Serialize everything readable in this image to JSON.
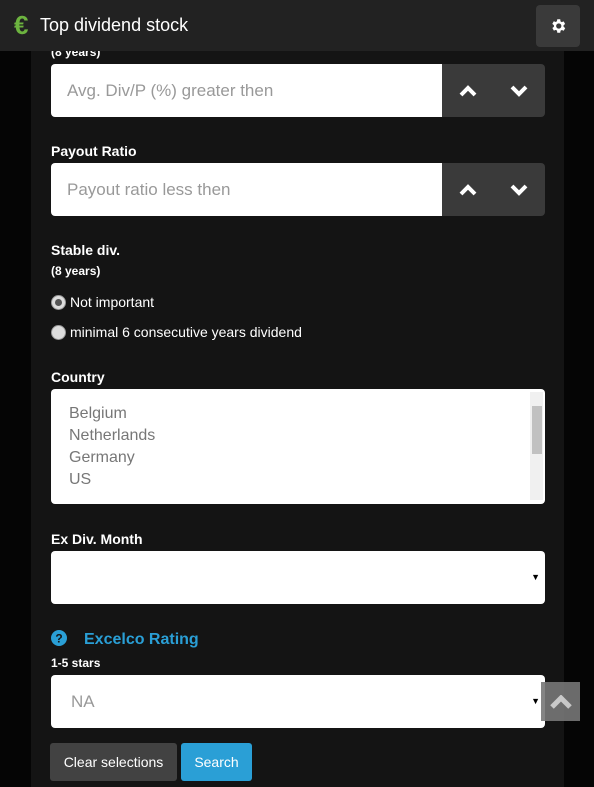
{
  "header": {
    "logo": "€",
    "title": "Top dividend stock",
    "settings_icon": "gear-icon"
  },
  "avg_div": {
    "sub": "(8 years)",
    "placeholder": "Avg. Div/P (%) greater then"
  },
  "payout": {
    "label": "Payout Ratio",
    "placeholder": "Payout ratio less then"
  },
  "stable": {
    "label": "Stable div.",
    "sub": "(8 years)",
    "options": [
      {
        "label": "Not important",
        "checked": true
      },
      {
        "label": "minimal 6 consecutive years dividend",
        "checked": false
      }
    ]
  },
  "country": {
    "label": "Country",
    "options": [
      "Belgium",
      "Netherlands",
      "Germany",
      "US"
    ]
  },
  "exdiv": {
    "label": "Ex Div. Month",
    "value": ""
  },
  "rating": {
    "label": "Excelco Rating",
    "sub": "1-5 stars",
    "value": "NA"
  },
  "buttons": {
    "clear": "Clear selections",
    "search": "Search"
  },
  "colors": {
    "accent": "#2a9fd6",
    "logo": "#6cb33f"
  }
}
